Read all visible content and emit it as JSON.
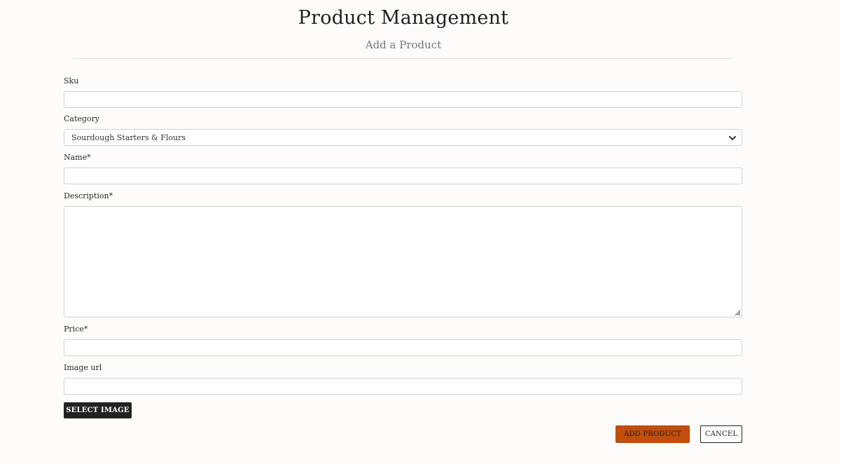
{
  "header": {
    "title": "Product Management",
    "subtitle": "Add a Product"
  },
  "form": {
    "sku": {
      "label": "Sku",
      "value": "",
      "placeholder": ""
    },
    "category": {
      "label": "Category",
      "selected": "Sourdough Starters & Flours"
    },
    "name": {
      "label": "Name*",
      "value": "",
      "placeholder": ""
    },
    "description": {
      "label": "Description*",
      "value": "",
      "placeholder": ""
    },
    "price": {
      "label": "Price*",
      "value": "",
      "placeholder": ""
    },
    "image_url": {
      "label": "Image url",
      "value": "",
      "placeholder": ""
    }
  },
  "buttons": {
    "select_image": "SELECT IMAGE",
    "add_product": "ADD PRODUCT",
    "cancel": "CANCEL"
  },
  "colors": {
    "accent": "#c24e0b",
    "dark_button": "#222222",
    "background": "#fdfcfa"
  },
  "icons": {
    "select_chevron": "chevron-down-icon",
    "textarea_grip": "resize-grip-icon"
  }
}
